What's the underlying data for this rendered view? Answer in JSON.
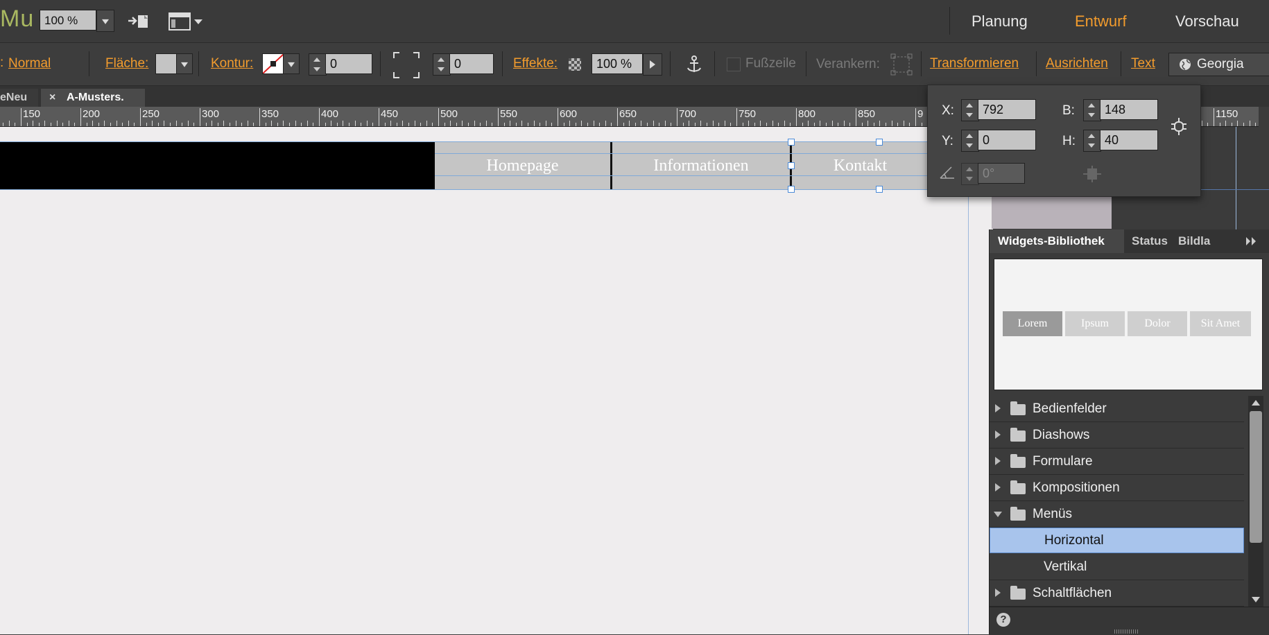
{
  "app": {
    "logo": "Mu"
  },
  "topbar": {
    "zoom": "100 %",
    "nav": [
      "Planung",
      "Entwurf",
      "Vorschau"
    ],
    "active_nav": "Entwurf"
  },
  "control": {
    "style": "Normal",
    "fill_label": "Fläche:",
    "stroke_label": "Kontur:",
    "stroke_value": "0",
    "corner_value": "0",
    "effects_label": "Effekte:",
    "opacity": "100 %",
    "footer_label": "Fußzeile",
    "anchor_label": "Verankern:",
    "transform_label": "Transformieren",
    "align_label": "Ausrichten",
    "text_label": "Text",
    "font_value": "Georgia"
  },
  "tabs": [
    {
      "label": "eNeu"
    },
    {
      "label": "A-Musters."
    }
  ],
  "ruler": {
    "labels": [
      "150",
      "200",
      "250",
      "300",
      "350",
      "400",
      "450",
      "500",
      "550",
      "600",
      "650",
      "700",
      "750",
      "800",
      "850",
      "9",
      "1150"
    ]
  },
  "menu": {
    "items": [
      "Homepage",
      "Informationen",
      "Kontakt"
    ]
  },
  "transform_popup": {
    "x_label": "X:",
    "x": "792",
    "y_label": "Y:",
    "y": "0",
    "b_label": "B:",
    "b": "148",
    "h_label": "H:",
    "h": "40",
    "rotation": "0°"
  },
  "widgets": {
    "tabs": [
      "Widgets-Bibliothek",
      "Status",
      "Bildla"
    ],
    "preview": [
      "Lorem",
      "Ipsum",
      "Dolor",
      "Sit Amet"
    ],
    "tree": [
      {
        "label": "Bedienfelder",
        "type": "folder",
        "open": false
      },
      {
        "label": "Diashows",
        "type": "folder",
        "open": false
      },
      {
        "label": "Formulare",
        "type": "folder",
        "open": false
      },
      {
        "label": "Kompositionen",
        "type": "folder",
        "open": false
      },
      {
        "label": "Menüs",
        "type": "folder",
        "open": true
      },
      {
        "label": "Horizontal",
        "type": "item",
        "selected": true
      },
      {
        "label": "Vertikal",
        "type": "item",
        "selected": false
      },
      {
        "label": "Schaltflächen",
        "type": "folder",
        "open": false
      }
    ],
    "help": "?"
  },
  "colors": {
    "accent": "#f39c2d",
    "selection": "#a8c4ec",
    "logo": "#a9b861"
  }
}
